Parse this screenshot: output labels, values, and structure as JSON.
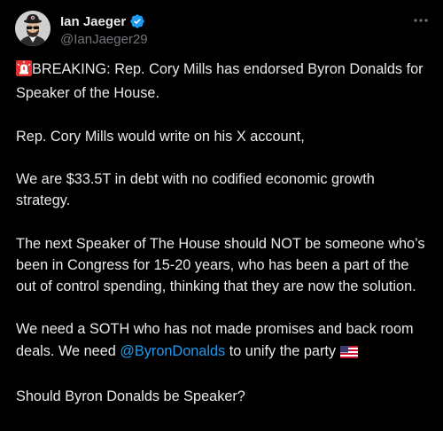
{
  "author": {
    "display_name": "Ian Jaeger",
    "handle": "@IanJaeger29",
    "verified": true,
    "verified_color": "#1d9bf0"
  },
  "more_icon": "more-horizontal-icon",
  "tweet": {
    "p1_text": "BREAKING: Rep. Cory Mills has endorsed Byron Donalds for Speaker of the House.",
    "p1_emoji": "rotating-light-emoji",
    "p2_text": "Rep. Cory Mills would write on his X account,",
    "p3_text": "We are $33.5T in debt with no codified economic growth strategy.",
    "p4_text": "The next Speaker of The House should NOT be someone who’s been in Congress for 15-20 years, who has been a part of the out of control spending, thinking that they are now the solution.",
    "p5_before": "We need a SOTH who has not made promises and back room deals. We need ",
    "p5_mention": "@ByronDonalds",
    "p5_after": " to unify the party ",
    "p5_emoji": "us-flag-emoji",
    "p6_text": "Should Byron Donalds be Speaker?"
  },
  "colors": {
    "background": "#000000",
    "text": "#e7e9ea",
    "secondary": "#71767b",
    "link": "#1d9bf0"
  }
}
